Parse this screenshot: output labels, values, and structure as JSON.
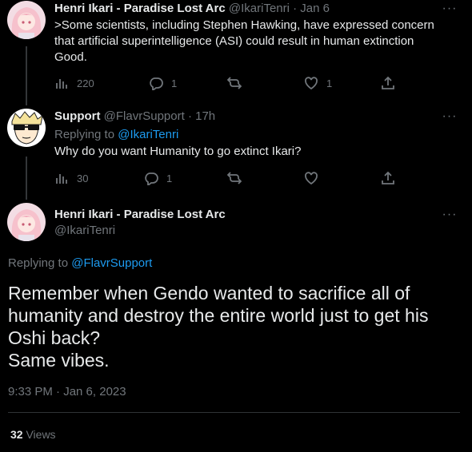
{
  "tweets": [
    {
      "name": "Henri Ikari - Paradise Lost Arc",
      "handle": "@IkariTenri",
      "sep": "·",
      "time": "Jan 6",
      "text_lines": [
        ">Some scientists, including Stephen Hawking, have expressed concern",
        "that artificial superintelligence (ASI) could result in human extinction",
        "Good."
      ],
      "views": "220",
      "replies": "1",
      "retweets": "",
      "likes": "1"
    },
    {
      "name": "Support",
      "handle": "@FlavrSupport",
      "sep": "·",
      "time": "17h",
      "replying_prefix": "Replying to",
      "replying_handle": "@IkariTenri",
      "text_lines": [
        "Why do you want Humanity to go extinct Ikari?"
      ],
      "views": "30",
      "replies": "1",
      "retweets": "",
      "likes": ""
    }
  ],
  "main": {
    "name": "Henri Ikari - Paradise Lost Arc",
    "handle": "@IkariTenri",
    "replying_prefix": "Replying to",
    "replying_handle": "@FlavrSupport",
    "text_lines": [
      "Remember when Gendo wanted to sacrifice all of",
      "humanity and destroy the entire world just to get his",
      "Oshi back?",
      "Same vibes."
    ],
    "timestamp": "9:33 PM · Jan 6, 2023",
    "views_count": "32",
    "views_label": "Views"
  },
  "icons": {
    "more": "more-icon",
    "views": "views-icon",
    "reply": "reply-icon",
    "retweet": "retweet-icon",
    "like": "like-icon",
    "share": "share-icon"
  },
  "colors": {
    "background": "#000000",
    "text": "#e7e9ea",
    "muted": "#71767b",
    "link": "#1d9bf0",
    "divider": "#2f3336"
  }
}
